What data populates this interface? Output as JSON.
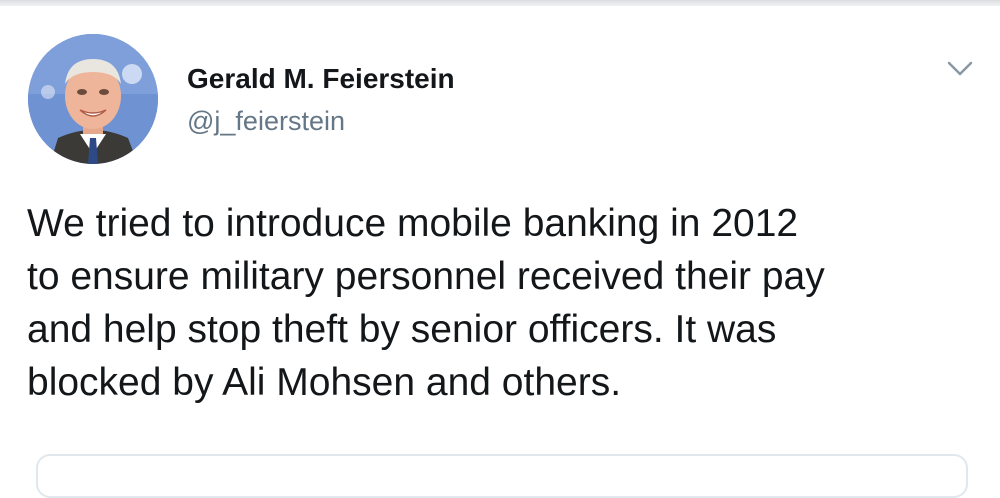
{
  "tweet": {
    "author": {
      "display_name": "Gerald M. Feierstein",
      "handle": "@j_feierstein",
      "avatar_icon": "profile-photo"
    },
    "menu_icon": "chevron-down-icon",
    "text_lines": [
      "We tried to introduce mobile banking in 2012",
      "to ensure military personnel received their pay",
      "and help stop theft by senior officers. It was",
      "blocked by Ali Mohsen and others."
    ]
  },
  "colors": {
    "text_primary": "#14171a",
    "text_secondary": "#657786",
    "border": "#e1e8ed",
    "background": "#ffffff"
  }
}
